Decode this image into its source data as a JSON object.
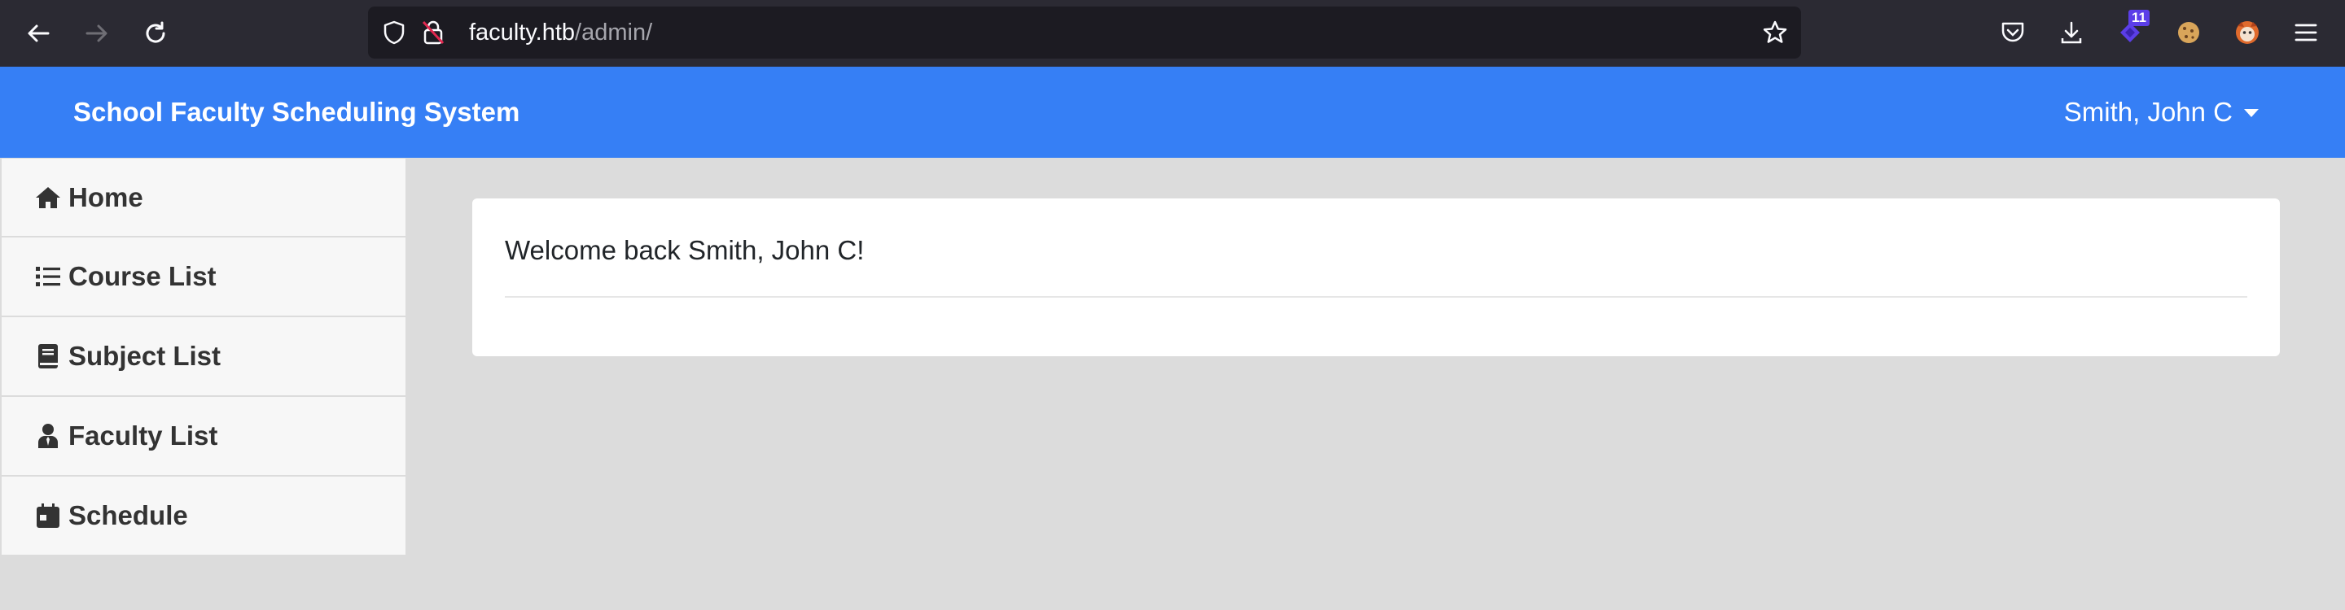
{
  "browser": {
    "url_host": "faculty.htb",
    "url_path": "/admin/",
    "extension_badge": "11",
    "icons": [
      "back-icon",
      "forward-icon",
      "reload-icon",
      "shield-icon",
      "insecure-lock-icon",
      "bookmark-star-icon",
      "pocket-icon",
      "download-icon",
      "extension-icon",
      "cookie-icon",
      "extension-fox-icon",
      "menu-icon"
    ]
  },
  "header": {
    "title": "School Faculty Scheduling System",
    "user_name": "Smith, John C"
  },
  "sidebar": {
    "items": [
      {
        "label": "Home",
        "icon": "home-icon"
      },
      {
        "label": "Course List",
        "icon": "list-icon"
      },
      {
        "label": "Subject List",
        "icon": "book-icon"
      },
      {
        "label": "Faculty List",
        "icon": "user-tie-icon"
      },
      {
        "label": "Schedule",
        "icon": "calendar-icon"
      }
    ]
  },
  "main": {
    "welcome_text": "Welcome back Smith, John C!"
  },
  "colors": {
    "header_bg": "#367ff5",
    "page_bg": "#dcdcdc",
    "browser_bg": "#2b2a33"
  }
}
